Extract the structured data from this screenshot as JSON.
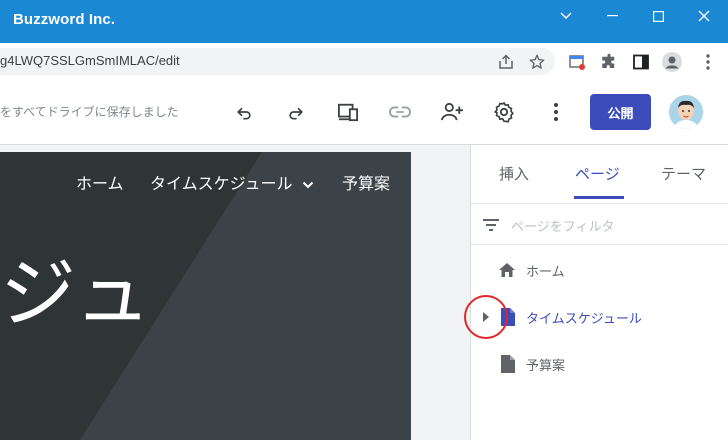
{
  "window": {
    "title": "Buzzword Inc."
  },
  "addressbar": {
    "url": "g4LWQ7SSLGmSmIMLAC/edit"
  },
  "toolbar": {
    "saved_status": "をすべてドライブに保存しました",
    "publish_label": "公開"
  },
  "preview": {
    "nav": [
      "ホーム",
      "タイムスケジュール",
      "予算案"
    ],
    "hero_text": "ジュ"
  },
  "panel": {
    "tabs": [
      "挿入",
      "ページ",
      "テーマ"
    ],
    "active_tab": "ページ",
    "filter_placeholder": "ページをフィルタ",
    "pages": [
      {
        "label": "ホーム",
        "icon": "home-icon"
      },
      {
        "label": "タイムスケジュール",
        "icon": "page-icon",
        "selected": true,
        "has_children": true
      },
      {
        "label": "予算案",
        "icon": "page-icon"
      }
    ]
  },
  "colors": {
    "titlebar": "#1b88d3",
    "accent": "#3c4dbb",
    "highlight_ring": "#e0282a",
    "preview_bg": "#2f3437"
  }
}
